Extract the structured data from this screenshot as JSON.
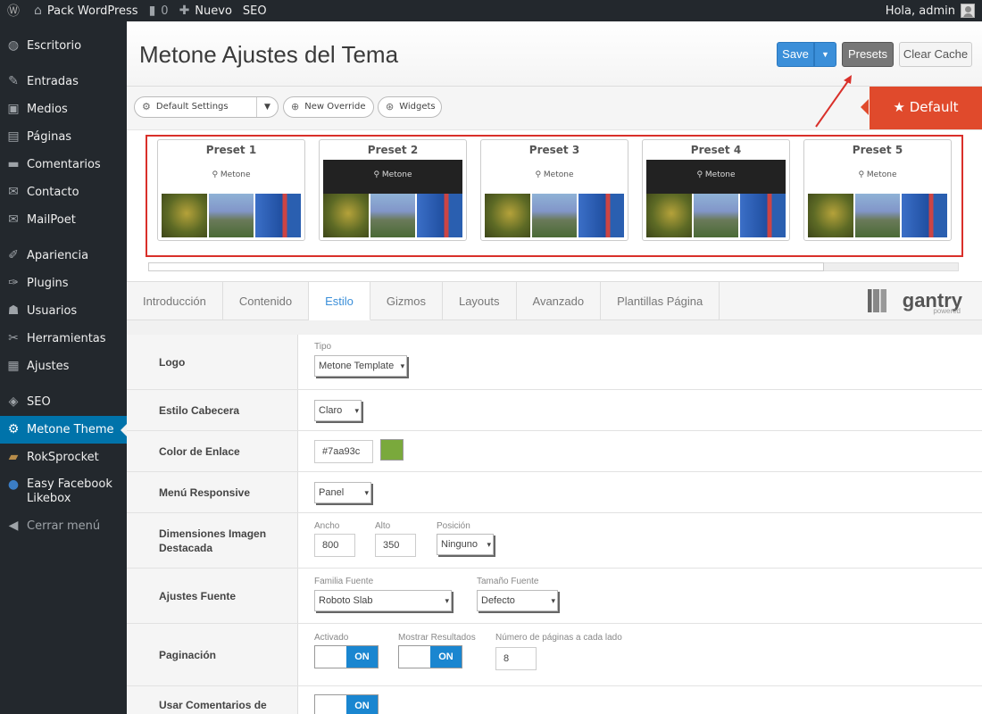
{
  "adminbar": {
    "site_name": "Pack WordPress",
    "comments_count": "0",
    "new_label": "Nuevo",
    "seo_label": "SEO",
    "greeting": "Hola, admin"
  },
  "sidebar": {
    "items": [
      {
        "label": "Escritorio",
        "icon": "dashboard-icon"
      },
      {
        "label": "Entradas",
        "icon": "pin-icon"
      },
      {
        "label": "Medios",
        "icon": "media-icon"
      },
      {
        "label": "Páginas",
        "icon": "pages-icon"
      },
      {
        "label": "Comentarios",
        "icon": "comments-icon"
      },
      {
        "label": "Contacto",
        "icon": "mail-icon"
      },
      {
        "label": "MailPoet",
        "icon": "mail-icon"
      },
      {
        "label": "Apariencia",
        "icon": "brush-icon"
      },
      {
        "label": "Plugins",
        "icon": "plugin-icon"
      },
      {
        "label": "Usuarios",
        "icon": "users-icon"
      },
      {
        "label": "Herramientas",
        "icon": "wrench-icon"
      },
      {
        "label": "Ajustes",
        "icon": "settings-icon"
      },
      {
        "label": "SEO",
        "icon": "seo-icon"
      },
      {
        "label": "Metone Theme",
        "icon": "gear-icon"
      },
      {
        "label": "RokSprocket",
        "icon": "box-icon"
      },
      {
        "label": "Easy Facebook Likebox",
        "icon": "facebook-icon"
      },
      {
        "label": "Cerrar menú",
        "icon": "collapse-icon"
      }
    ]
  },
  "header": {
    "title": "Metone Ajustes del Tema",
    "save": "Save",
    "presets": "Presets",
    "clear_cache": "Clear Cache"
  },
  "toolbar": {
    "default_settings": "Default Settings",
    "new_override": "New Override",
    "widgets": "Widgets",
    "default_badge": "★ Default"
  },
  "presets": [
    {
      "label": "Preset 1",
      "thumb": "Metone"
    },
    {
      "label": "Preset 2",
      "thumb": "Metone"
    },
    {
      "label": "Preset 3",
      "thumb": "Metone"
    },
    {
      "label": "Preset 4",
      "thumb": "Metone"
    },
    {
      "label": "Preset 5",
      "thumb": "Metone"
    }
  ],
  "tabs": [
    {
      "label": "Introducción"
    },
    {
      "label": "Contenido"
    },
    {
      "label": "Estilo"
    },
    {
      "label": "Gizmos"
    },
    {
      "label": "Layouts"
    },
    {
      "label": "Avanzado"
    },
    {
      "label": "Plantillas Página"
    }
  ],
  "gantry": {
    "name": "gantry",
    "sub": "powered"
  },
  "settings": {
    "logo": {
      "label": "Logo",
      "tipo_label": "Tipo",
      "tipo_value": "Metone Template"
    },
    "cabecera": {
      "label": "Estilo Cabecera",
      "value": "Claro"
    },
    "color": {
      "label": "Color de Enlace",
      "value": "#7aa93c",
      "swatch": "#7aa93c"
    },
    "menu": {
      "label": "Menú Responsive",
      "value": "Panel"
    },
    "dims": {
      "label": "Dimensiones Imagen Destacada",
      "ancho_label": "Ancho",
      "ancho": "800",
      "alto_label": "Alto",
      "alto": "350",
      "pos_label": "Posición",
      "pos": "Ninguno"
    },
    "fuente": {
      "label": "Ajustes Fuente",
      "familia_label": "Familia Fuente",
      "familia": "Roboto Slab",
      "tam_label": "Tamaño Fuente",
      "tam": "Defecto"
    },
    "paginacion": {
      "label": "Paginación",
      "activado_label": "Activado",
      "activado": "ON",
      "mostrar_label": "Mostrar Resultados",
      "mostrar": "ON",
      "num_label": "Número de páginas a cada lado",
      "num": "8"
    },
    "comentarios": {
      "label": "Usar Comentarios de",
      "value": "ON"
    }
  }
}
